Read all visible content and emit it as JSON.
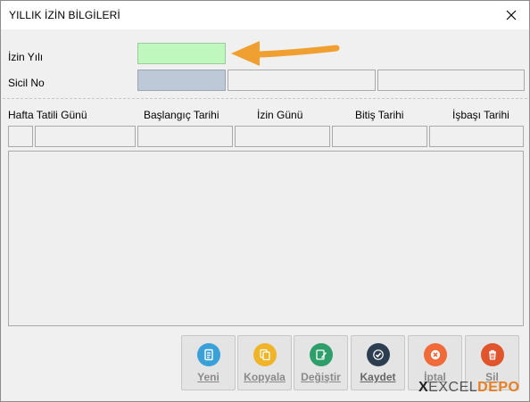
{
  "window": {
    "title": "YILLIK İZİN BİLGİLERİ"
  },
  "form": {
    "izin_yili_label": "İzin Yılı",
    "sicil_no_label": "Sicil No",
    "izin_yili_value": "",
    "sicil_no_value": "",
    "sicil_ad_value": "",
    "sicil_extra_value": ""
  },
  "table": {
    "columns": [
      "Hafta Tatili Günü",
      "Başlangıç Tarihi",
      "İzin Günü",
      "Bitiş Tarihi",
      "İşbaşı Tarihi"
    ]
  },
  "toolbar": {
    "buttons": [
      {
        "label": "Yeni",
        "icon": "document-icon",
        "color": "#3aa0d8"
      },
      {
        "label": "Kopyala",
        "icon": "copy-icon",
        "color": "#f0b429"
      },
      {
        "label": "Değiştir",
        "icon": "edit-icon",
        "color": "#2e9e6a"
      },
      {
        "label": "Kaydet",
        "icon": "check-icon",
        "color": "#2c3e50"
      },
      {
        "label": "İptal",
        "icon": "cancel-icon",
        "color": "#f06a3a"
      },
      {
        "label": "Sil",
        "icon": "trash-icon",
        "color": "#e0552b"
      }
    ]
  },
  "logo": {
    "part1": "X",
    "part2": "EXCEL",
    "part3": "DEPO"
  },
  "colors": {
    "arrow": "#f0a030",
    "green_field": "#bff7bf",
    "blue_field": "#bdc9d6"
  }
}
